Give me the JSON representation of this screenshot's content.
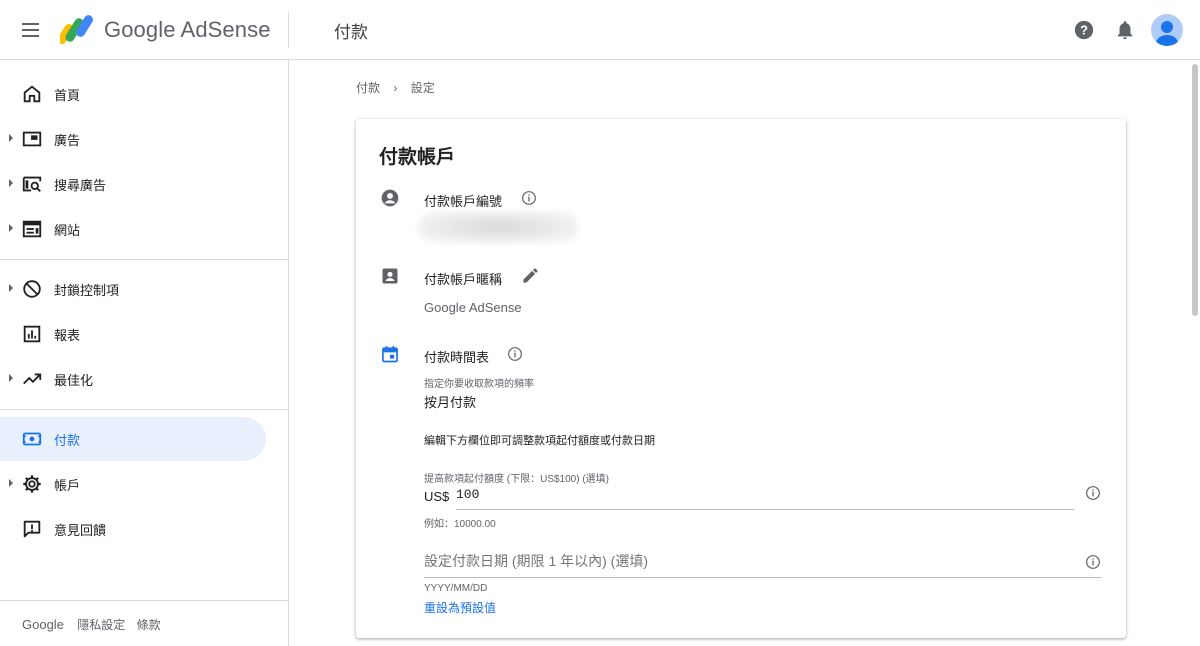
{
  "app": {
    "brand": "Google AdSense",
    "page_title": "付款"
  },
  "colors": {
    "accent": "#1a73e8",
    "active_nav_bg": "#e8f0fe",
    "text_primary": "#202124",
    "text_secondary": "#5f6368"
  },
  "header": {
    "icons": [
      "help-icon",
      "notifications-icon",
      "account-avatar"
    ]
  },
  "sidebar": {
    "items": [
      {
        "label": "首頁",
        "icon": "home-icon",
        "expandable": false
      },
      {
        "label": "廣告",
        "icon": "ads-icon",
        "expandable": true
      },
      {
        "label": "搜尋廣告",
        "icon": "search-ads-icon",
        "expandable": true
      },
      {
        "label": "網站",
        "icon": "sites-icon",
        "expandable": true
      },
      {
        "label": "封鎖控制項",
        "icon": "block-icon",
        "expandable": true
      },
      {
        "label": "報表",
        "icon": "reports-icon",
        "expandable": false
      },
      {
        "label": "最佳化",
        "icon": "trending-icon",
        "expandable": true
      },
      {
        "label": "付款",
        "icon": "payments-icon",
        "expandable": false,
        "active": true
      },
      {
        "label": "帳戶",
        "icon": "gear-icon",
        "expandable": true
      },
      {
        "label": "意見回饋",
        "icon": "feedback-icon",
        "expandable": false
      }
    ],
    "footer": {
      "google": "Google",
      "privacy": "隱私設定",
      "terms": "條款"
    }
  },
  "breadcrumb": [
    "付款",
    "設定"
  ],
  "card": {
    "title": "付款帳戶",
    "account_number": {
      "label": "付款帳戶編號"
    },
    "nickname": {
      "label": "付款帳戶暱稱",
      "value": "Google AdSense"
    },
    "schedule": {
      "label": "付款時間表",
      "frequency_hint": "指定你要收取款項的頻率",
      "frequency_value": "按月付款",
      "edit_note": "編輯下方欄位即可調整款項起付額度或付款日期",
      "threshold": {
        "label": "提高款項起付額度 (下限：US$100) (選填)",
        "currency": "US$",
        "value": "100",
        "example": "例如：10000.00"
      },
      "date": {
        "placeholder": "設定付款日期 (期限 1 年以內) (選填)",
        "format_hint": "YYYY/MM/DD",
        "reset_label": "重設為預設值"
      }
    }
  }
}
